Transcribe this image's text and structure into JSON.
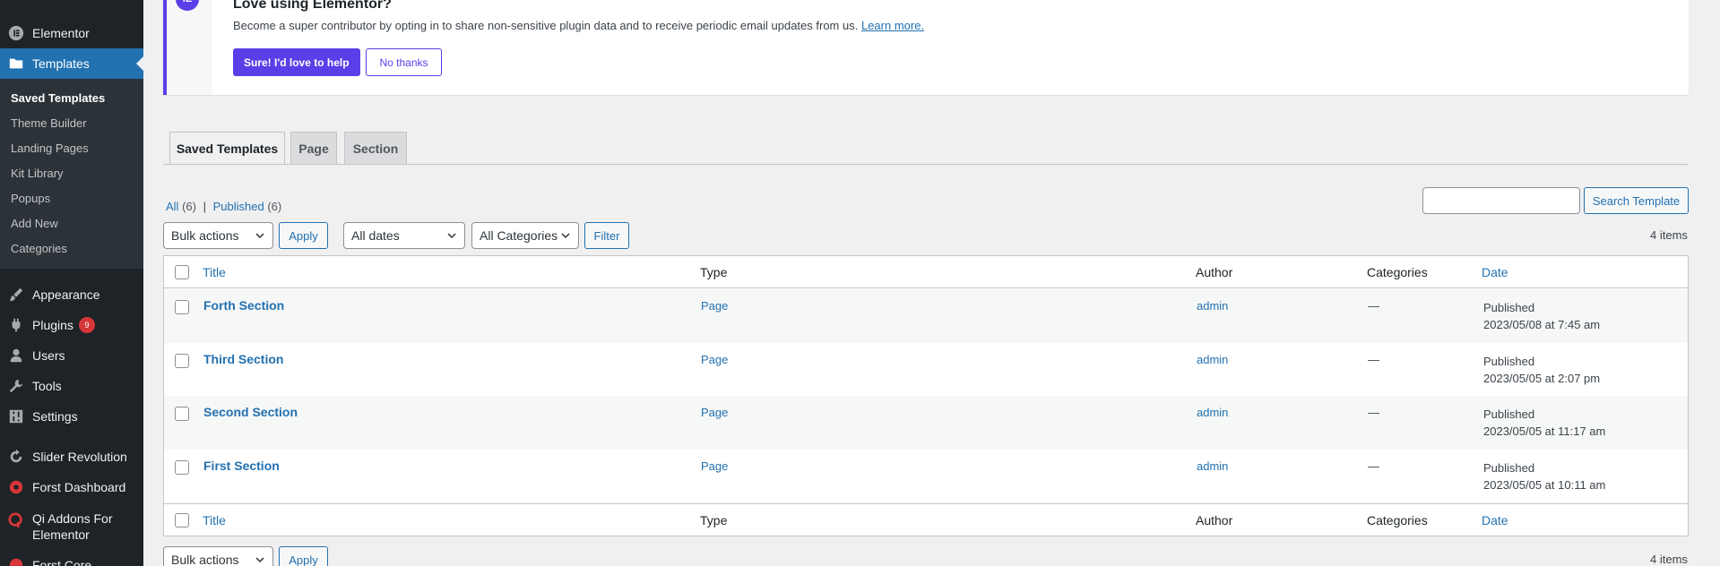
{
  "sidebar": {
    "elementor": "Elementor",
    "templates": "Templates",
    "submenu": [
      "Saved Templates",
      "Theme Builder",
      "Landing Pages",
      "Kit Library",
      "Popups",
      "Add New",
      "Categories"
    ],
    "appearance": "Appearance",
    "plugins": "Plugins",
    "plugins_badge": "9",
    "users": "Users",
    "tools": "Tools",
    "settings": "Settings",
    "slider_revolution": "Slider Revolution",
    "forst_dashboard": "Forst Dashboard",
    "qi_addons_1": "Qi Addons For",
    "qi_addons_2": "Elementor",
    "forst_core": "Forst Core"
  },
  "notice": {
    "logo": "IE",
    "title": "Love using Elementor?",
    "message": "Become a super contributor by opting in to share non-sensitive plugin data and to receive periodic email updates from us.",
    "learn_more": "Learn more.",
    "accept": "Sure! I'd love to help",
    "decline": "No thanks"
  },
  "tabs": [
    "Saved Templates",
    "Page",
    "Section"
  ],
  "views": {
    "all": "All",
    "all_count": "(6)",
    "sep": "|",
    "published": "Published",
    "published_count": "(6)"
  },
  "search": {
    "button": "Search Template",
    "value": ""
  },
  "filters": {
    "bulk_actions": "Bulk actions",
    "apply": "Apply",
    "dates": "All dates",
    "categories": "All Categories",
    "filter": "Filter"
  },
  "items_count": "4 items",
  "table": {
    "columns": {
      "title": "Title",
      "type": "Type",
      "author": "Author",
      "categories": "Categories",
      "date": "Date"
    },
    "rows": [
      {
        "title": "Forth Section",
        "type": "Page",
        "author": "admin",
        "categories": "—",
        "status": "Published",
        "date": "2023/05/08 at 7:45 am"
      },
      {
        "title": "Third Section",
        "type": "Page",
        "author": "admin",
        "categories": "—",
        "status": "Published",
        "date": "2023/05/05 at 2:07 pm"
      },
      {
        "title": "Second Section",
        "type": "Page",
        "author": "admin",
        "categories": "—",
        "status": "Published",
        "date": "2023/05/05 at 11:17 am"
      },
      {
        "title": "First Section",
        "type": "Page",
        "author": "admin",
        "categories": "—",
        "status": "Published",
        "date": "2023/05/05 at 10:11 am"
      }
    ]
  },
  "colors": {
    "accent": "#2271b1",
    "elementor": "#5a3fe8",
    "sidebar": "#1d2327",
    "badge": "#d63638"
  }
}
